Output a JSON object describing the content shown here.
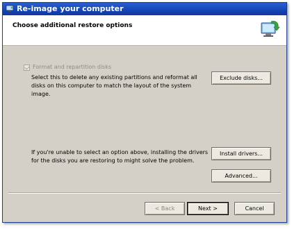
{
  "window": {
    "title": "Re-image your computer"
  },
  "header": {
    "heading": "Choose additional restore options",
    "icon": "computer-restore-icon"
  },
  "options": {
    "format_checkbox": {
      "label": "Format and repartition disks",
      "checked": true,
      "enabled": false
    },
    "format_description": "Select this to delete any existing partitions and reformat all disks on this computer to match the layout of the system image.",
    "exclude_button": "Exclude disks...",
    "driver_note": "If you're unable to select an option above, installing the drivers for the disks you are restoring to might solve the problem.",
    "install_drivers_button": "Install drivers...",
    "advanced_button": "Advanced..."
  },
  "footer": {
    "back_label": "< Back",
    "next_label": "Next >",
    "cancel_label": "Cancel"
  }
}
